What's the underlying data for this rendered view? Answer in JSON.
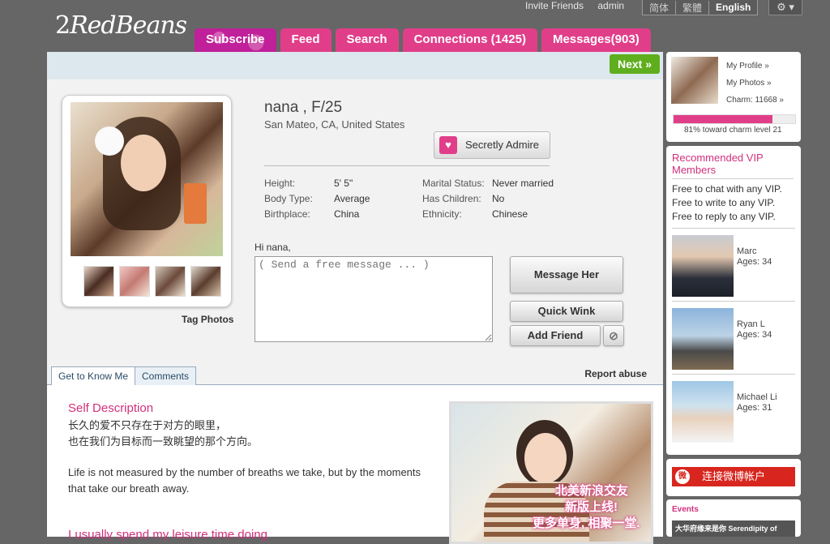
{
  "brand": {
    "logo_prefix": "2",
    "logo_main": "RedBeans"
  },
  "toplinks": {
    "invite": "Invite Friends",
    "user": "admin"
  },
  "languages": [
    "简体",
    "繁體",
    "English"
  ],
  "settings": {
    "icon": "gear-icon",
    "caret": "▾"
  },
  "nav": [
    {
      "label": "Subscribe"
    },
    {
      "label": "Feed"
    },
    {
      "label": "Search"
    },
    {
      "label": "Connections (1425)"
    },
    {
      "label": "Messages(903)"
    }
  ],
  "next_label": "Next »",
  "profile": {
    "name_line": "nana , F/25",
    "location": "San Mateo, CA, United States",
    "admire_label": "Secretly Admire",
    "tag_photos": "Tag Photos",
    "attributes": {
      "height_k": "Height:",
      "height_v": "5' 5\"",
      "body_k": "Body Type:",
      "body_v": "Average",
      "birth_k": "Birthplace:",
      "birth_v": "China",
      "marital_k": "Marital Status:",
      "marital_v": "Never married",
      "children_k": "Has Children:",
      "children_v": "No",
      "ethnicity_k": "Ethnicity:",
      "ethnicity_v": "Chinese"
    }
  },
  "message": {
    "greeting": "Hi nana,",
    "placeholder": "( Send a free message ... )",
    "message_btn": "Message Her",
    "wink_btn": "Quick Wink",
    "add_btn": "Add Friend",
    "block_icon": "⊘"
  },
  "tabs": {
    "know": "Get to Know Me",
    "comments": "Comments",
    "report": "Report abuse"
  },
  "about": {
    "self_heading": "Self Description",
    "cn_line1": "长久的爱不只存在于对方的眼里，",
    "cn_line2": "也在我们为目标而一致眺望的那个方向。",
    "en_text": "Life is not measured by the number of breaths we take, but by the moments that take our breath away.",
    "leisure_heading": "I usually spend my leisure time doing",
    "promo_line1": "北美新浪交友",
    "promo_line2": "新版上线!",
    "promo_line3": "更多单身, 相聚一堂."
  },
  "sidebar": {
    "my_profile": "My Profile »",
    "my_photos": "My Photos »",
    "charm": "Charm: 11668 »",
    "charm_progress": 0.81,
    "charm_text": "81% toward charm level 21",
    "vip_heading": "Recommended VIP Members",
    "perks": [
      "Free to chat with any VIP.",
      "Free to write to any VIP.",
      "Free to reply to any VIP."
    ],
    "members": [
      {
        "name": "Marc",
        "age": "Ages: 34"
      },
      {
        "name": "Ryan L",
        "age": "Ages: 34"
      },
      {
        "name": "Michael Li",
        "age": "Ages: 31"
      }
    ],
    "weibo": "连接微博帐户",
    "events_heading": "Events",
    "event_item": "大华府缘来是你 Serendipity of"
  }
}
